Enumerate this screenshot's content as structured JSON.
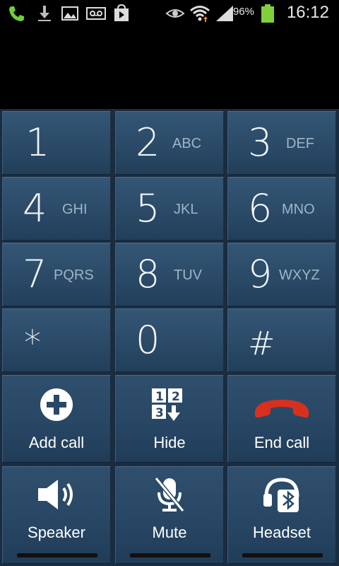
{
  "status_bar": {
    "icons": [
      "phone-call-icon",
      "download-icon",
      "gallery-icon",
      "voicemail-icon",
      "play-store-icon",
      "eye-icon",
      "wifi-icon",
      "signal-icon",
      "battery-icon"
    ],
    "battery_percent": "96%",
    "time": "16:12"
  },
  "dialpad": {
    "keys": [
      {
        "digit": "1",
        "letters": ""
      },
      {
        "digit": "2",
        "letters": "ABC"
      },
      {
        "digit": "3",
        "letters": "DEF"
      },
      {
        "digit": "4",
        "letters": "GHI"
      },
      {
        "digit": "5",
        "letters": "JKL"
      },
      {
        "digit": "6",
        "letters": "MNO"
      },
      {
        "digit": "7",
        "letters": "PQRS"
      },
      {
        "digit": "8",
        "letters": "TUV"
      },
      {
        "digit": "9",
        "letters": "WXYZ"
      },
      {
        "digit": "*",
        "letters": ""
      },
      {
        "digit": "0",
        "letters": ""
      },
      {
        "digit": "#",
        "letters": ""
      }
    ]
  },
  "actions": {
    "add_call": "Add call",
    "hide": "Hide",
    "end_call": "End call",
    "speaker": "Speaker",
    "mute": "Mute",
    "headset": "Headset"
  },
  "colors": {
    "end_call_red": "#d9301e",
    "battery_green": "#7fd03a",
    "key_blue": "#2c4c6a"
  }
}
